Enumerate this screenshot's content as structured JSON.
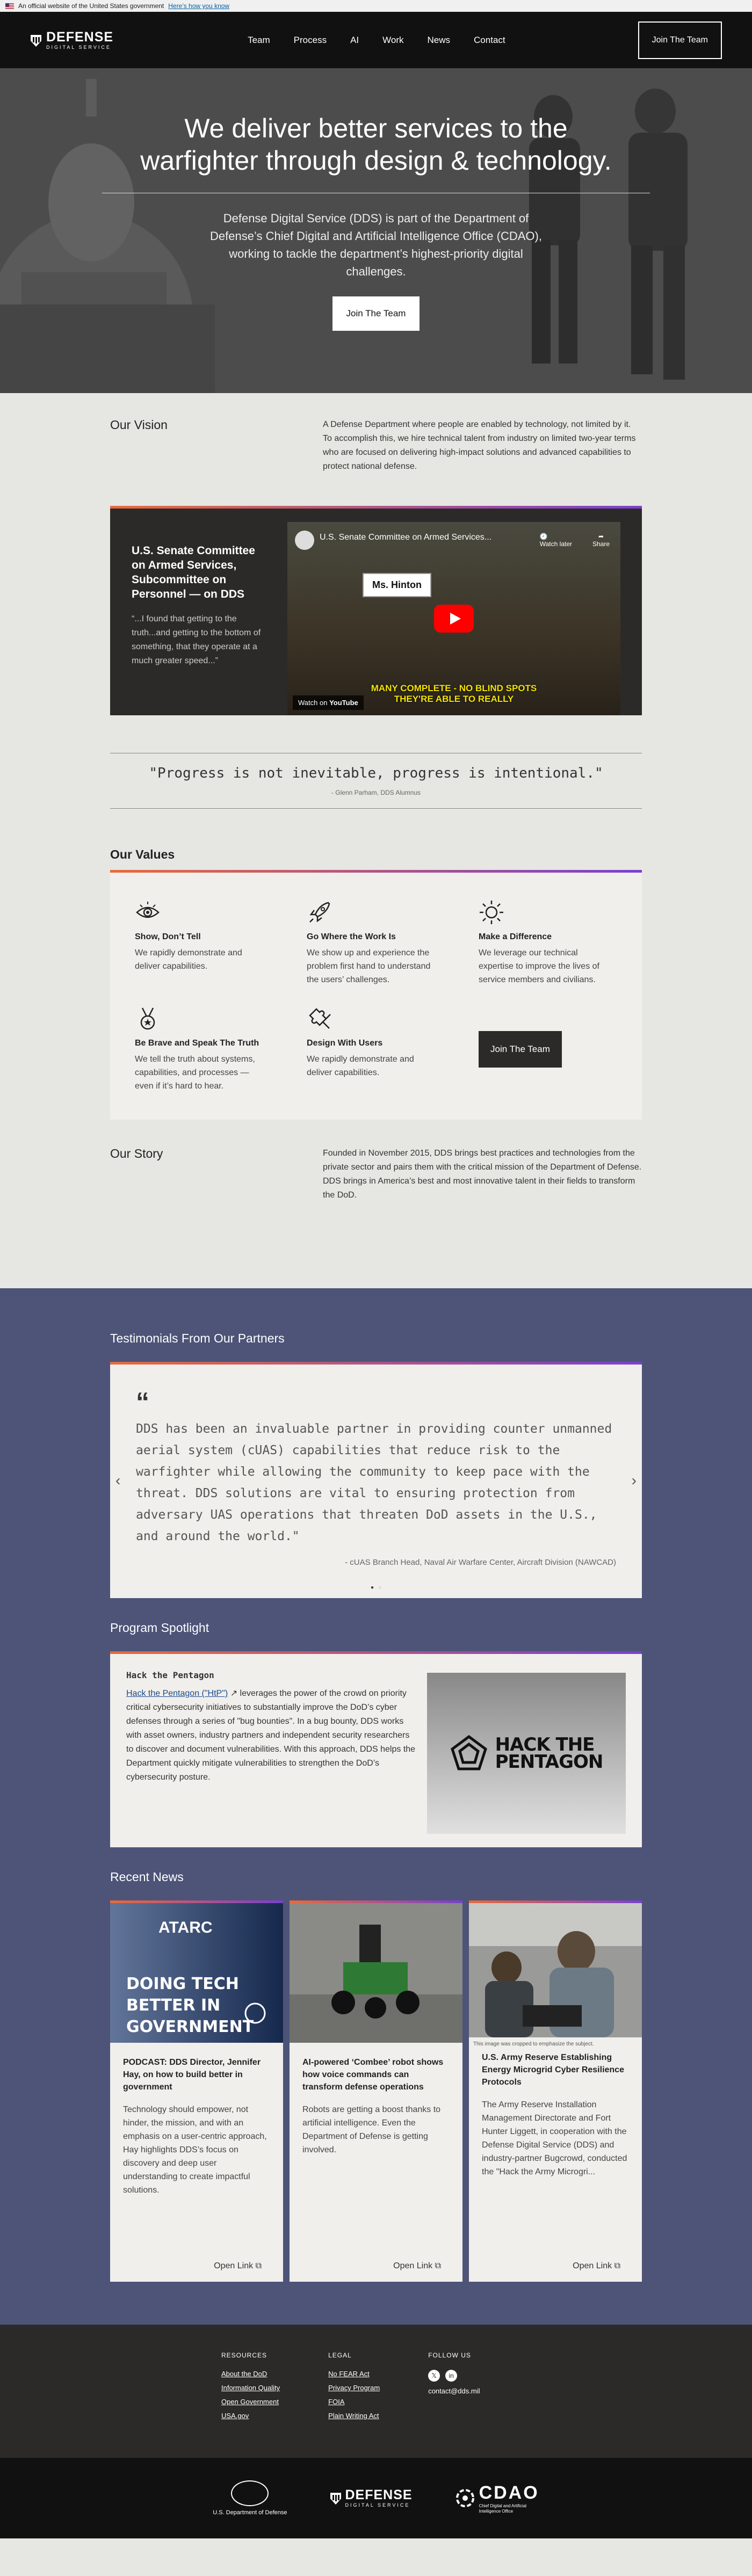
{
  "gov_banner": {
    "text": "An official website of the United States government",
    "link": "Here’s how you know"
  },
  "header": {
    "logo_line1": "DEFENSE",
    "logo_line2": "DIGITAL SERVICE",
    "nav": [
      "Team",
      "Process",
      "AI",
      "Work",
      "News",
      "Contact"
    ],
    "join": "Join The Team"
  },
  "hero": {
    "title": "We deliver better services to the warfighter through design & technology.",
    "body": "Defense Digital Service (DDS) is part of the Department of Defense’s Chief Digital and Artificial Intelligence Office (CDAO), working to tackle the department’s highest-priority digital challenges.",
    "button": "Join The Team"
  },
  "vision": {
    "heading": "Our Vision",
    "text": "A Defense Department where people are enabled by technology, not limited by it. To accomplish this, we hire technical talent from industry on limited two-year terms who are focused on delivering high-impact solutions and advanced capabilities to protect national defense."
  },
  "video": {
    "heading": "U.S. Senate Committee on Armed Services, Subcommittee on Personnel — on DDS",
    "quote": "“...I found that getting to the truth...and getting to the bottom of something, that they operate at a much greater speed...”",
    "player_title": "U.S. Senate Committee on Armed Services...",
    "watch_later": "Watch later",
    "share": "Share",
    "nameplate": "Ms. Hinton",
    "caption_line1": "MANY COMPLETE - NO BLIND SPOTS",
    "caption_line2": "THEY'RE ABLE TO REALLY",
    "watch_on": "Watch on",
    "youtube": "YouTube"
  },
  "quote": {
    "text": "\"Progress is not inevitable, progress is intentional.\"",
    "by": "- Glenn Parham, DDS Alumnus"
  },
  "values": {
    "heading": "Our Values",
    "items": [
      {
        "icon": "eye-icon",
        "title": "Show, Don’t Tell",
        "text": "We rapidly demonstrate and deliver capabilities."
      },
      {
        "icon": "rocket-icon",
        "title": "Go Where the Work Is",
        "text": "We show up and experience the problem first hand to understand the users’ challenges."
      },
      {
        "icon": "sun-icon",
        "title": "Make a Difference",
        "text": "We leverage our technical expertise to improve the lives of service members and civilians."
      },
      {
        "icon": "medal-icon",
        "title": "Be Brave and Speak The Truth",
        "text": "We tell the truth about systems, capabilities, and processes — even if it’s hard to hear."
      },
      {
        "icon": "puzzle-icon",
        "title": "Design With Users",
        "text": "We rapidly demonstrate and deliver capabilities."
      }
    ],
    "join": "Join The Team"
  },
  "story": {
    "heading": "Our Story",
    "text": "Founded in November 2015, DDS brings best practices and technologies from the private sector and pairs them with the critical mission of the Department of Defense. DDS brings in America’s best and most innovative talent in their fields to transform the DoD."
  },
  "testimonials": {
    "heading": "Testimonials From Our Partners",
    "quote_mark": "“",
    "text": "DDS has been an invaluable partner in providing counter unmanned aerial system (cUAS) capabilities that reduce risk to the warfighter while allowing the community to keep pace with the threat. DDS solutions are vital to ensuring protection from adversary UAS operations that threaten DoD assets in the U.S., and around the world.\"",
    "by": "- cUAS Branch Head, Naval Air Warfare Center, Aircraft Division (NAWCAD)"
  },
  "spotlight": {
    "heading": "Program Spotlight",
    "title": "Hack the Pentagon",
    "link": "Hack the Pentagon (\"HtP\")",
    "text": " leverages the power of the crowd on priority critical cybersecurity initiatives to substantially improve the DoD’s cyber defenses through a series of \"bug bounties\". In a bug bounty, DDS works with asset owners, industry partners and independent security researchers to discover and document vulnerabilities. With this approach, DDS helps the Department quickly mitigate vulnerabilities to strengthen the DoD’s cybersecurity posture.",
    "logo_line1": "HACK THE",
    "logo_line2": "PENTAGON"
  },
  "news": {
    "heading": "Recent News",
    "items": [
      {
        "title": "PODCAST: DDS Director, Jennifer Hay, on how to build better in government",
        "text": "Technology should empower, not hinder, the mission, and with an emphasis on a user-centric approach, Hay highlights DDS’s focus on discovery and deep user understanding to create impactful solutions.",
        "link": "Open Link",
        "img_text1": "ATARC",
        "img_text2": "DOING TECH BETTER IN GOVERNMENT"
      },
      {
        "title": "AI-powered ‘Combee’ robot shows how voice commands can transform defense operations",
        "text": "Robots are getting a boost thanks to artificial intelligence. Even the Department of Defense is getting involved.",
        "link": "Open Link"
      },
      {
        "title": "U.S. Army Reserve Establishing Energy Microgrid Cyber Resilience Protocols",
        "text": "The Army Reserve Installation Management Directorate and Fort Hunter Liggett, in cooperation with the Defense Digital Service (DDS) and industry-partner Bugcrowd, conducted the \"Hack the Army Microgri...",
        "link": "Open Link",
        "caption": "This image was cropped to emphasize the subject."
      }
    ]
  },
  "footer": {
    "resources_title": "RESOURCES",
    "resources": [
      "About the DoD",
      "Information Quality",
      "Open Government",
      "USA.gov"
    ],
    "legal_title": "LEGAL",
    "legal": [
      "No FEAR Act",
      "Privacy Program",
      "FOIA",
      "Plain Writing Act"
    ],
    "follow_title": "FOLLOW US",
    "email": "contact@dds.mil",
    "dod_label": "U.S. Department of Defense",
    "dds_line1": "DEFENSE",
    "dds_line2": "DIGITAL SERVICE",
    "cdao_big": "CDAO",
    "cdao_small": "Chief Digital and Artificial Intelligence Office"
  }
}
